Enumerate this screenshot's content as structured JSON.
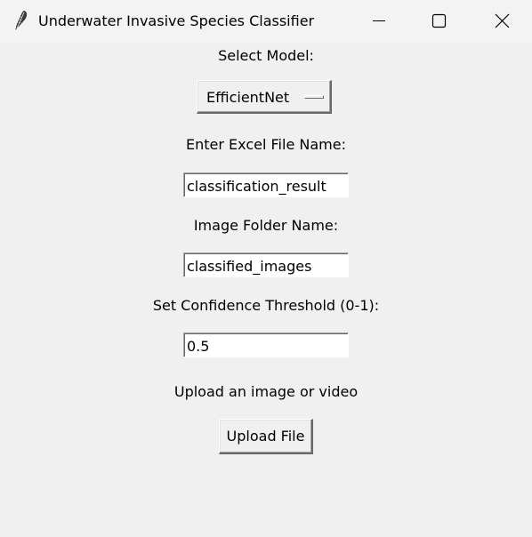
{
  "window": {
    "title": "Underwater Invasive Species Classifier",
    "icon": "feather-icon",
    "controls": [
      "minimize-icon",
      "maximize-icon",
      "close-icon"
    ]
  },
  "model": {
    "label": "Select Model:",
    "selected": "EfficientNet"
  },
  "excel": {
    "label": "Enter Excel File Name:",
    "value": "classification_result"
  },
  "folder": {
    "label": "Image Folder Name:",
    "value": "classified_images"
  },
  "threshold": {
    "label": "Set Confidence Threshold (0-1):",
    "value": "0.5"
  },
  "upload": {
    "label": "Upload an image or video",
    "button_label": "Upload File"
  },
  "colors": {
    "background": "#f0f0f0",
    "titlebar": "#f3f3f3",
    "entry_bg": "#ffffff"
  }
}
